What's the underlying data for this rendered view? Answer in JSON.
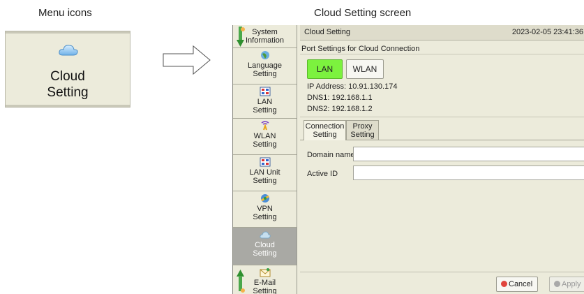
{
  "captions": {
    "menu_icons": "Menu icons",
    "cloud_screen": "Cloud Setting screen"
  },
  "menu_tile": {
    "label_line1": "Cloud",
    "label_line2": "Setting",
    "icon": "cloud-icon"
  },
  "sidebar": {
    "items": [
      {
        "line1": "System",
        "line2": "Information",
        "icon": "info-icon"
      },
      {
        "line1": "Language",
        "line2": "Setting",
        "icon": "globe-icon"
      },
      {
        "line1": "LAN",
        "line2": "Setting",
        "icon": "network-icon"
      },
      {
        "line1": "WLAN",
        "line2": "Setting",
        "icon": "wifi-icon"
      },
      {
        "line1": "LAN Unit",
        "line2": "Setting",
        "icon": "network-icon"
      },
      {
        "line1": "VPN",
        "line2": "Setting",
        "icon": "vpn-icon"
      },
      {
        "line1": "Cloud",
        "line2": "Setting",
        "icon": "cloud-icon",
        "active": true
      },
      {
        "line1": "E-Mail",
        "line2": "Setting",
        "icon": "mail-icon"
      }
    ]
  },
  "header": {
    "title": "Cloud Setting",
    "datetime": "2023-02-05 23:41:36"
  },
  "port_settings": {
    "label": "Port Settings for Cloud Connection",
    "lan_label": "LAN",
    "wlan_label": "WLAN",
    "ip_address": "IP Address: 10.91.130.174",
    "dns1": "DNS1: 192.168.1.1",
    "dns2": "DNS2: 192.168.1.2"
  },
  "tabs": [
    {
      "line1": "Connection",
      "line2": "Setting",
      "active": true
    },
    {
      "line1": "Proxy",
      "line2": "Setting",
      "active": false
    }
  ],
  "form": {
    "domain_label": "Domain name",
    "domain_value": "",
    "active_id_label": "Active ID",
    "active_id_value": ""
  },
  "footer": {
    "cancel_label": "Cancel",
    "apply_label": "Apply"
  },
  "colors": {
    "lan_active": "#7cf23e",
    "panel_bg": "#ecebdb",
    "cancel_icon": "#e0443c"
  }
}
